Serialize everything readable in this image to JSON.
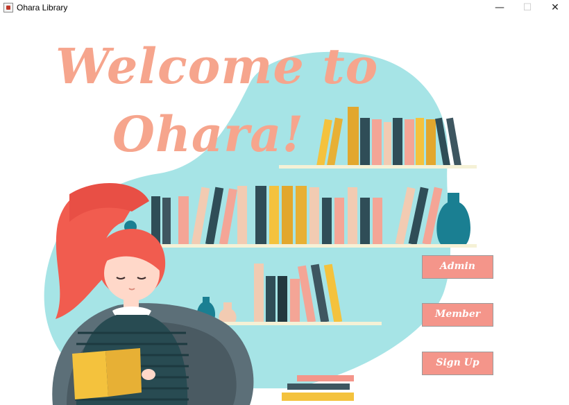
{
  "window": {
    "title": "Ohara Library",
    "minimize_glyph": "—",
    "maximize_glyph": "☐",
    "close_glyph": "✕"
  },
  "welcome": {
    "line1": "Welcome to",
    "line2": "Ohara!"
  },
  "buttons": {
    "admin": "Admin",
    "member": "Member",
    "signup": "Sign Up"
  },
  "colors": {
    "heading": "#f6a58d",
    "button_fill": "#f4958a",
    "blob": "#a6e4e6",
    "shelf": "#f5f1d6",
    "hair": "#f15c4f"
  },
  "icons": {
    "app": "java-cup-icon"
  }
}
